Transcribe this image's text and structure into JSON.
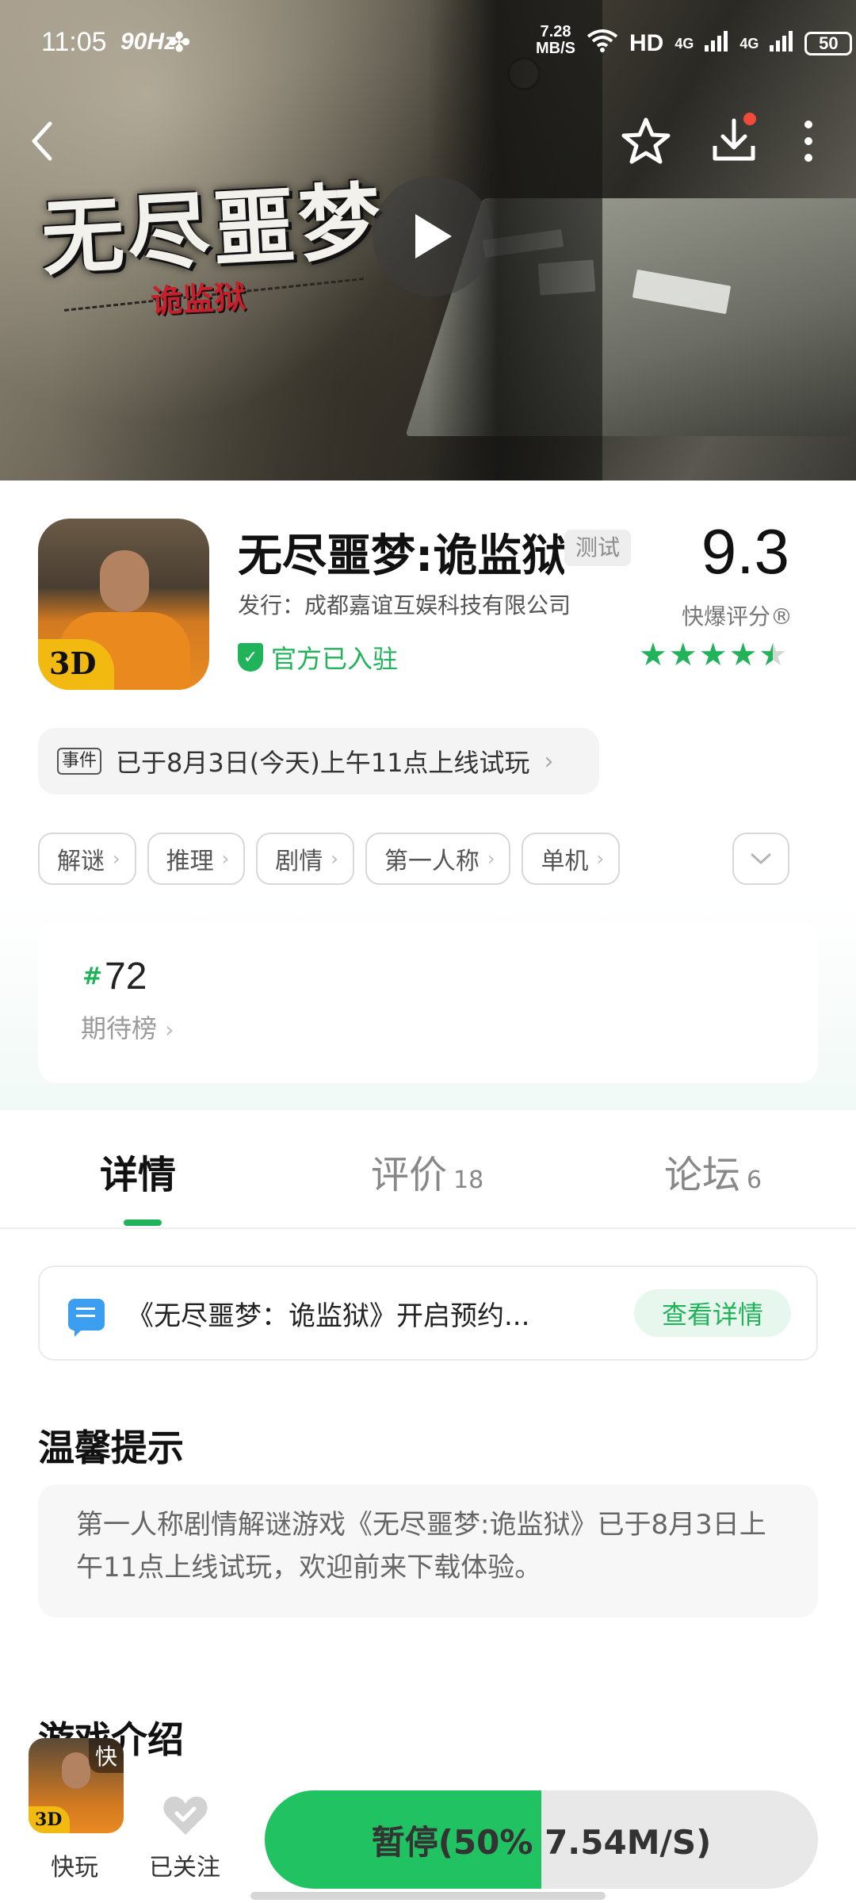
{
  "status": {
    "time": "11:05",
    "refresh_rate": "90Hz",
    "net_speed_value": "7.28",
    "net_speed_unit": "MB/S",
    "network": "HD",
    "signal_1": "4G",
    "signal_2": "4G",
    "battery": "50"
  },
  "hero": {
    "logo_title": "无尽噩梦",
    "logo_subtitle": "诡监狱"
  },
  "app": {
    "title": "无尽噩梦:诡监狱",
    "test_tag": "测试",
    "publisher": "发行：成都嘉谊互娱科技有限公司",
    "official_label": "官方已入驻",
    "icon_badge": "3D",
    "score": "9.3",
    "score_label": "快爆评分®",
    "rating": 4.5
  },
  "event": {
    "tag": "事件",
    "text": "已于8月3日(今天)上午11点上线试玩"
  },
  "tags": [
    "解谜",
    "推理",
    "剧情",
    "第一人称",
    "单机"
  ],
  "rank": {
    "hash": "#",
    "number": "72",
    "label": "期待榜"
  },
  "tabs": [
    {
      "label": "详情",
      "count": ""
    },
    {
      "label": "评价",
      "count": "18"
    },
    {
      "label": "论坛",
      "count": "6"
    }
  ],
  "notice": {
    "text": "《无尽噩梦：诡监狱》开启预约...",
    "button": "查看详情"
  },
  "tips": {
    "heading": "温馨提示",
    "body": "第一人称剧情解谜游戏《无尽噩梦:诡监狱》已于8月3日上午11点上线试玩，欢迎前来下载体验。"
  },
  "intro": {
    "heading": "游戏介绍"
  },
  "bottom": {
    "quick_badge": "快",
    "quick_label": "快玩",
    "quick_icon_badge": "3D",
    "follow_label": "已关注",
    "progress_percent": 50,
    "progress_text": "暂停(50% 7.54M/S)"
  },
  "colors": {
    "accent": "#21b35a",
    "progress": "#21c262"
  }
}
